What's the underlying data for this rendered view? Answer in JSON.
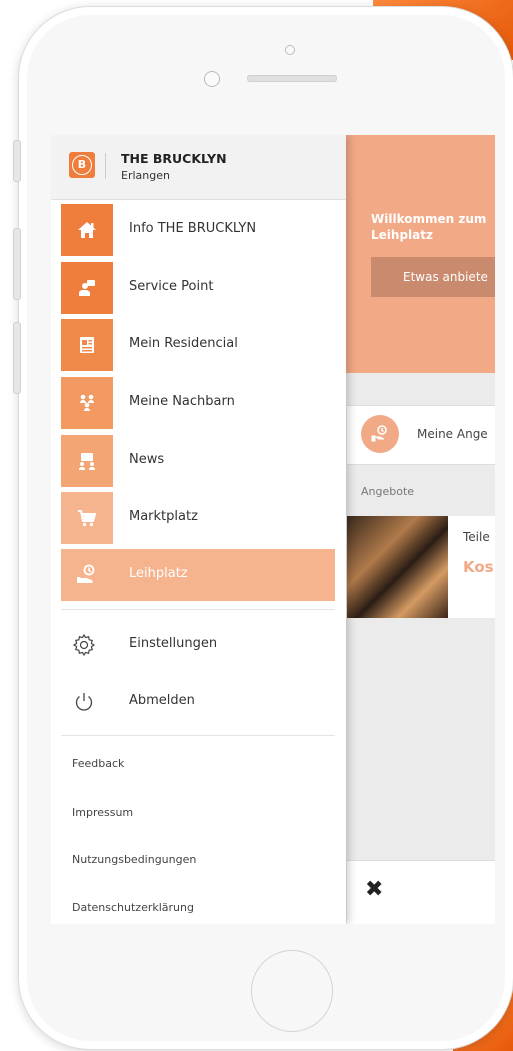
{
  "drawer": {
    "header": {
      "logo_letter": "B",
      "title": "THE BRUCKLYN",
      "subtitle": "Erlangen"
    },
    "menu_items": [
      {
        "label": "Info THE BRUCKLYN",
        "icon": "home-icon",
        "color": "#ef7d3b"
      },
      {
        "label": "Service Point",
        "icon": "service-point-icon",
        "color": "#ef7d3b"
      },
      {
        "label": "Mein Residencial",
        "icon": "document-icon",
        "color": "#f08a4b"
      },
      {
        "label": "Meine Nachbarn",
        "icon": "neighbors-icon",
        "color": "#f29a61"
      },
      {
        "label": "News",
        "icon": "news-icon",
        "color": "#f3a574"
      },
      {
        "label": "Marktplatz",
        "icon": "cart-icon",
        "color": "#f5b48e"
      },
      {
        "label": "Leihplatz",
        "icon": "lend-icon",
        "color": "#f5b48e",
        "active": true
      }
    ],
    "settings": [
      {
        "label": "Einstellungen",
        "icon": "gear-icon"
      },
      {
        "label": "Abmelden",
        "icon": "power-icon"
      }
    ],
    "footer_links": [
      "Feedback",
      "Impressum",
      "Nutzungsbedingungen",
      "Datenschutzerklärung"
    ]
  },
  "app": {
    "hero_title_line1": "Willkommen zum",
    "hero_title_line2": "Leihplatz",
    "hero_button": "Etwas anbiete",
    "offer_row_label": "Meine Ange",
    "section_label": "Angebote",
    "card_text": "Teile",
    "card_price": "Kos",
    "close_symbol": "✖"
  },
  "colors": {
    "accent": "#ef7d3b",
    "accent_light": "#f5b48e",
    "hero": "#f2a986"
  }
}
